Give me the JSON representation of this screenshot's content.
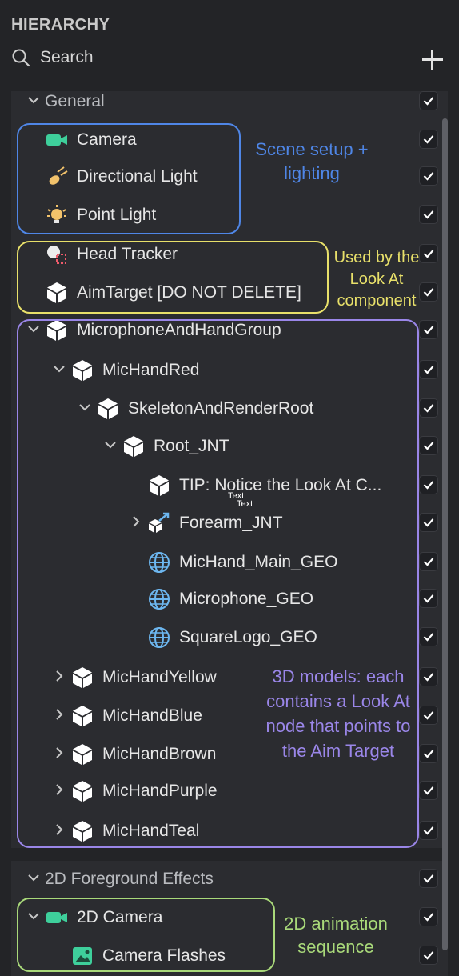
{
  "header": {
    "title": "HIERARCHY",
    "search_placeholder": "Search"
  },
  "sections": [
    {
      "label": "General"
    },
    {
      "label": "2D Foreground Effects"
    }
  ],
  "rows": [
    {
      "label": "General",
      "type": "section",
      "chev": "down"
    },
    {
      "label": "Camera",
      "icon": "camera-icon"
    },
    {
      "label": "Directional Light",
      "icon": "directional-light-icon"
    },
    {
      "label": "Point Light",
      "icon": "point-light-icon"
    },
    {
      "label": "Head Tracker",
      "icon": "head-tracker-icon"
    },
    {
      "label": "AimTarget [DO NOT DELETE]",
      "icon": "cube-icon"
    },
    {
      "label": "MicrophoneAndHandGroup",
      "icon": "cube-icon",
      "chev": "down"
    },
    {
      "label": "MicHandRed",
      "icon": "cube-icon",
      "chev": "down"
    },
    {
      "label": "SkeletonAndRenderRoot",
      "icon": "cube-icon",
      "chev": "down"
    },
    {
      "label": "Root_JNT",
      "icon": "cube-icon",
      "chev": "down"
    },
    {
      "label": "TIP: Notice the Look At C...",
      "icon": "cube-icon"
    },
    {
      "label": "Forearm_JNT",
      "icon": "joint-icon",
      "chev": "right"
    },
    {
      "label": "MicHand_Main_GEO",
      "icon": "mesh-globe-icon"
    },
    {
      "label": "Microphone_GEO",
      "icon": "mesh-globe-icon"
    },
    {
      "label": "SquareLogo_GEO",
      "icon": "mesh-globe-icon"
    },
    {
      "label": "MicHandYellow",
      "icon": "cube-icon",
      "chev": "right"
    },
    {
      "label": "MicHandBlue",
      "icon": "cube-icon",
      "chev": "right"
    },
    {
      "label": "MicHandBrown",
      "icon": "cube-icon",
      "chev": "right"
    },
    {
      "label": "MicHandPurple",
      "icon": "cube-icon",
      "chev": "right"
    },
    {
      "label": "MicHandTeal",
      "icon": "cube-icon",
      "chev": "right"
    },
    {
      "label": "2D Foreground Effects",
      "type": "section",
      "chev": "down"
    },
    {
      "label": "2D Camera",
      "icon": "camera-icon",
      "chev": "down"
    },
    {
      "label": "Camera Flashes",
      "icon": "image-icon"
    }
  ],
  "annotations": {
    "scene": "Scene setup + lighting",
    "lookat": "Used by the Look At component",
    "models": "3D models: each contains a Look At node that points to the Aim Target",
    "anim": "2D animation sequence",
    "tiny1": "Text",
    "tiny2": "Text"
  },
  "colors": {
    "blue": "#4f86e6",
    "yellow": "#e8e06a",
    "purple": "#9a86e8",
    "green": "#a9d97a",
    "teal": "#3ecf9b"
  }
}
